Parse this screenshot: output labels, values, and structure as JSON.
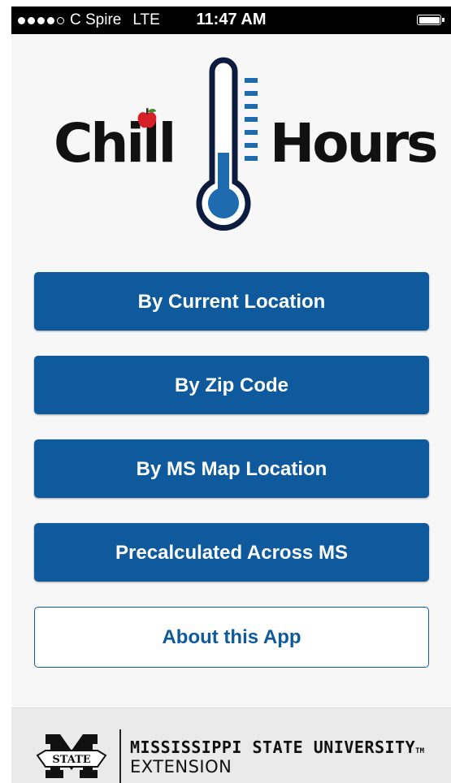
{
  "status_bar": {
    "carrier": "C Spire",
    "network": "LTE",
    "time": "11:47 AM",
    "signal_bars_filled": 4,
    "signal_bars_total": 5
  },
  "logo": {
    "word_left": "Chill",
    "word_right": "Hours",
    "colors": {
      "thermometer_outline": "#0d1b3e",
      "mercury": "#1e6bb0",
      "apple": "#d62128"
    }
  },
  "menu": {
    "items": [
      {
        "label": "By Current Location"
      },
      {
        "label": "By Zip Code"
      },
      {
        "label": "By MS Map Location"
      },
      {
        "label": "Precalculated Across MS"
      }
    ],
    "about_label": "About this App"
  },
  "footer": {
    "university": "MISSISSIPPI STATE UNIVERSITY",
    "trademark": "TM",
    "department": "EXTENSION",
    "seal_text": "STATE"
  },
  "colors": {
    "primary": "#0f5a9c",
    "background": "#f7f7f7",
    "footer_bg": "#eaeaea"
  }
}
